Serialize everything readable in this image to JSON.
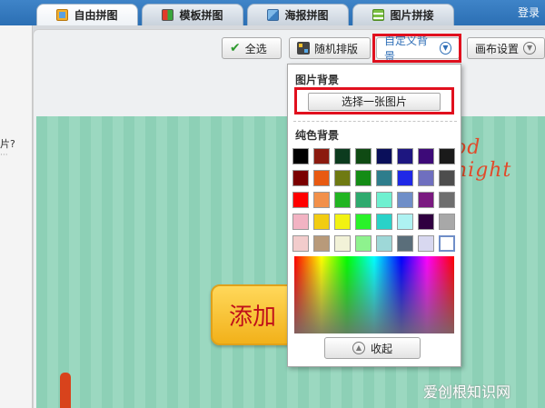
{
  "tabs": [
    {
      "label": "自由拼图",
      "icon": "free-collage-icon",
      "active": true
    },
    {
      "label": "模板拼图",
      "icon": "template-collage-icon",
      "active": false
    },
    {
      "label": "海报拼图",
      "icon": "poster-collage-icon",
      "active": false
    },
    {
      "label": "图片拼接",
      "icon": "image-stitch-icon",
      "active": false
    }
  ],
  "header": {
    "login": "登录"
  },
  "sidebar": {
    "question": "片?",
    "dots": "···"
  },
  "toolbar": {
    "select_all": "全选",
    "random_layout": "随机排版",
    "custom_background": "自定义背景",
    "canvas_settings": "画布设置"
  },
  "popup": {
    "image_bg_label": "图片背景",
    "choose_image": "选择一张图片",
    "solid_bg_label": "纯色背景",
    "collapse": "收起",
    "swatches": [
      "#000000",
      "#8b1a0f",
      "#0c3b1e",
      "#0f4a13",
      "#0a0f5a",
      "#1d1680",
      "#3d0a78",
      "#1a1a1a",
      "#7a0000",
      "#e85a12",
      "#6f7a12",
      "#148c16",
      "#2e7d8c",
      "#1f28e6",
      "#6f6fbf",
      "#4d4d4d",
      "#ff0000",
      "#f2904a",
      "#22b522",
      "#2eaa6e",
      "#6ff0d0",
      "#6f8ec8",
      "#7a1a80",
      "#6e6e6e",
      "#f2b3c3",
      "#f2cc12",
      "#f2f212",
      "#2af22a",
      "#2ad2c8",
      "#aef2f2",
      "#300040",
      "#a8a8a8",
      "#f2cccc",
      "#b89a7a",
      "#f2f2d8",
      "#8ef28e",
      "#9ed8d8",
      "#5a6e7a",
      "#d8d8f0",
      "#ffffff"
    ],
    "selected_swatch": 39
  },
  "canvas": {
    "greeting": "od night",
    "add_button": "添加"
  },
  "watermark": "爱创根知识网",
  "colors": {
    "accent": "#2f6fb7",
    "highlight": "#e1101e",
    "canvas_bg": "#8dd0b6"
  }
}
